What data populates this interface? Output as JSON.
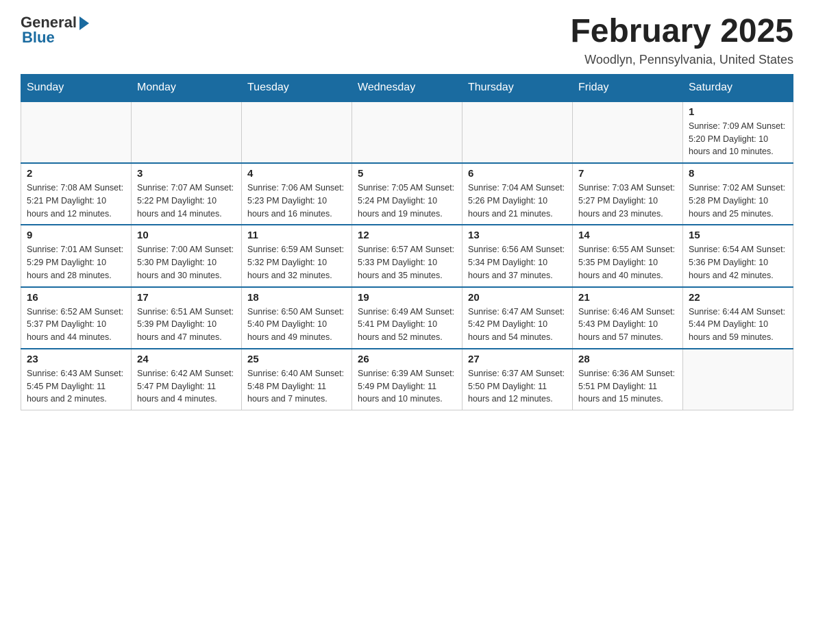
{
  "logo": {
    "general": "General",
    "blue": "Blue"
  },
  "title": "February 2025",
  "location": "Woodlyn, Pennsylvania, United States",
  "days_of_week": [
    "Sunday",
    "Monday",
    "Tuesday",
    "Wednesday",
    "Thursday",
    "Friday",
    "Saturday"
  ],
  "weeks": [
    [
      {
        "day": "",
        "info": ""
      },
      {
        "day": "",
        "info": ""
      },
      {
        "day": "",
        "info": ""
      },
      {
        "day": "",
        "info": ""
      },
      {
        "day": "",
        "info": ""
      },
      {
        "day": "",
        "info": ""
      },
      {
        "day": "1",
        "info": "Sunrise: 7:09 AM\nSunset: 5:20 PM\nDaylight: 10 hours and 10 minutes."
      }
    ],
    [
      {
        "day": "2",
        "info": "Sunrise: 7:08 AM\nSunset: 5:21 PM\nDaylight: 10 hours and 12 minutes."
      },
      {
        "day": "3",
        "info": "Sunrise: 7:07 AM\nSunset: 5:22 PM\nDaylight: 10 hours and 14 minutes."
      },
      {
        "day": "4",
        "info": "Sunrise: 7:06 AM\nSunset: 5:23 PM\nDaylight: 10 hours and 16 minutes."
      },
      {
        "day": "5",
        "info": "Sunrise: 7:05 AM\nSunset: 5:24 PM\nDaylight: 10 hours and 19 minutes."
      },
      {
        "day": "6",
        "info": "Sunrise: 7:04 AM\nSunset: 5:26 PM\nDaylight: 10 hours and 21 minutes."
      },
      {
        "day": "7",
        "info": "Sunrise: 7:03 AM\nSunset: 5:27 PM\nDaylight: 10 hours and 23 minutes."
      },
      {
        "day": "8",
        "info": "Sunrise: 7:02 AM\nSunset: 5:28 PM\nDaylight: 10 hours and 25 minutes."
      }
    ],
    [
      {
        "day": "9",
        "info": "Sunrise: 7:01 AM\nSunset: 5:29 PM\nDaylight: 10 hours and 28 minutes."
      },
      {
        "day": "10",
        "info": "Sunrise: 7:00 AM\nSunset: 5:30 PM\nDaylight: 10 hours and 30 minutes."
      },
      {
        "day": "11",
        "info": "Sunrise: 6:59 AM\nSunset: 5:32 PM\nDaylight: 10 hours and 32 minutes."
      },
      {
        "day": "12",
        "info": "Sunrise: 6:57 AM\nSunset: 5:33 PM\nDaylight: 10 hours and 35 minutes."
      },
      {
        "day": "13",
        "info": "Sunrise: 6:56 AM\nSunset: 5:34 PM\nDaylight: 10 hours and 37 minutes."
      },
      {
        "day": "14",
        "info": "Sunrise: 6:55 AM\nSunset: 5:35 PM\nDaylight: 10 hours and 40 minutes."
      },
      {
        "day": "15",
        "info": "Sunrise: 6:54 AM\nSunset: 5:36 PM\nDaylight: 10 hours and 42 minutes."
      }
    ],
    [
      {
        "day": "16",
        "info": "Sunrise: 6:52 AM\nSunset: 5:37 PM\nDaylight: 10 hours and 44 minutes."
      },
      {
        "day": "17",
        "info": "Sunrise: 6:51 AM\nSunset: 5:39 PM\nDaylight: 10 hours and 47 minutes."
      },
      {
        "day": "18",
        "info": "Sunrise: 6:50 AM\nSunset: 5:40 PM\nDaylight: 10 hours and 49 minutes."
      },
      {
        "day": "19",
        "info": "Sunrise: 6:49 AM\nSunset: 5:41 PM\nDaylight: 10 hours and 52 minutes."
      },
      {
        "day": "20",
        "info": "Sunrise: 6:47 AM\nSunset: 5:42 PM\nDaylight: 10 hours and 54 minutes."
      },
      {
        "day": "21",
        "info": "Sunrise: 6:46 AM\nSunset: 5:43 PM\nDaylight: 10 hours and 57 minutes."
      },
      {
        "day": "22",
        "info": "Sunrise: 6:44 AM\nSunset: 5:44 PM\nDaylight: 10 hours and 59 minutes."
      }
    ],
    [
      {
        "day": "23",
        "info": "Sunrise: 6:43 AM\nSunset: 5:45 PM\nDaylight: 11 hours and 2 minutes."
      },
      {
        "day": "24",
        "info": "Sunrise: 6:42 AM\nSunset: 5:47 PM\nDaylight: 11 hours and 4 minutes."
      },
      {
        "day": "25",
        "info": "Sunrise: 6:40 AM\nSunset: 5:48 PM\nDaylight: 11 hours and 7 minutes."
      },
      {
        "day": "26",
        "info": "Sunrise: 6:39 AM\nSunset: 5:49 PM\nDaylight: 11 hours and 10 minutes."
      },
      {
        "day": "27",
        "info": "Sunrise: 6:37 AM\nSunset: 5:50 PM\nDaylight: 11 hours and 12 minutes."
      },
      {
        "day": "28",
        "info": "Sunrise: 6:36 AM\nSunset: 5:51 PM\nDaylight: 11 hours and 15 minutes."
      },
      {
        "day": "",
        "info": ""
      }
    ]
  ]
}
